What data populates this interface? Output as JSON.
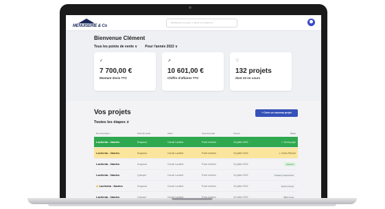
{
  "app": {
    "logo_text": "MENUISERIE & Co",
    "search_placeholder": "Rechercher un projet, un devis, une référence…"
  },
  "header": {
    "welcome": "Bienvenue Clément",
    "filter_sales": "Tous les points de vente ∨",
    "filter_year": "Pour l'année 2022 ∨"
  },
  "cards": [
    {
      "icon": "✓",
      "value": "7 700,00 €",
      "label": "Montant devis TTC"
    },
    {
      "icon": "↗",
      "value": "10 601,00 €",
      "label": "Chiffre d'affaires TTC"
    },
    {
      "icon": "♡",
      "value": "132 projets",
      "label": "dont 23 en cours"
    }
  ],
  "projects": {
    "title": "Vos projets",
    "new_button": "+ Créer un nouveau projet",
    "steps_filter": "Toutes les étapes ∨",
    "columns": [
      "Nom du projet ↓",
      "Point de vente",
      "Client",
      "Type de projet",
      "Créé le",
      "Étape"
    ],
    "rows": [
      {
        "name": "Laclienta - Nantes",
        "store": "Duquesa",
        "client": "Carole Laclient",
        "type": "Porte entrées",
        "date": "16 juillet 2022",
        "stage": "✓ Devis payé",
        "style": "green"
      },
      {
        "name": "Laclienta - Nantes",
        "store": "Duquesa",
        "client": "Carole Laclient",
        "type": "Porte entrées",
        "date": "16 juillet 2022",
        "stage": "⚠ Devis Refusé",
        "style": "yellow"
      },
      {
        "name": "Laclienta - Nantes",
        "store": "Duquesa",
        "client": "Carole Laclient",
        "type": "Porte entrées",
        "date": "16 juillet 2022",
        "stage": "Devis lu",
        "style": "pill-green"
      },
      {
        "name": "Laclienta - Nantes",
        "store": "Quimper",
        "client": "Carole Laclient",
        "type": "Porte entrées",
        "date": "16 juillet 2022",
        "stage": "Travaux programmés",
        "style": "pill-gray"
      },
      {
        "name": "Laclienta - Nantes",
        "store": "Duquesa",
        "client": "Carole Laclient",
        "type": "Porte entrées",
        "date": "16 juillet 2022",
        "stage": "Devis envoyé",
        "style": "pill-gray",
        "warn": true
      },
      {
        "name": "Laclienta - Nantes",
        "store": "Quimper",
        "client": "Carole Laclient",
        "type": "Porte entrées",
        "date": "16 juillet 2022",
        "stage": "BDV reçus",
        "style": "pill-gray"
      }
    ]
  }
}
